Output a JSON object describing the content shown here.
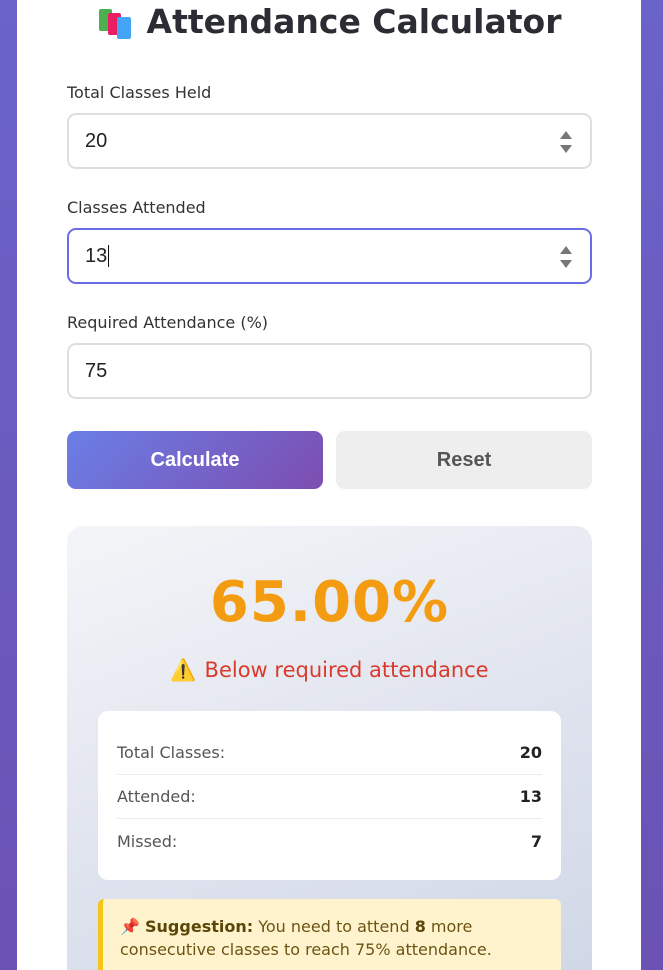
{
  "header": {
    "icon": "books-icon",
    "title": "Attendance Calculator"
  },
  "form": {
    "total_label": "Total Classes Held",
    "total_value": "20",
    "attended_label": "Classes Attended",
    "attended_value": "13",
    "required_label": "Required Attendance (%)",
    "required_value": "75"
  },
  "buttons": {
    "calculate": "Calculate",
    "reset": "Reset"
  },
  "result": {
    "percentage": "65.00%",
    "status_icon": "⚠️",
    "status_text": "Below required attendance",
    "stats": [
      {
        "label": "Total Classes:",
        "value": "20"
      },
      {
        "label": "Attended:",
        "value": "13"
      },
      {
        "label": "Missed:",
        "value": "7"
      }
    ],
    "suggestion": {
      "icon": "📌",
      "lead": "Suggestion:",
      "text_before": "You need to attend",
      "count": "8",
      "text_after": "more consecutive classes to reach 75% attendance."
    }
  },
  "colors": {
    "accent_start": "#6a7fe6",
    "accent_end": "#7d4db0",
    "percentage": "#f39c12",
    "warning": "#d93a2b",
    "suggestion_bg": "#fff3cd",
    "suggestion_border": "#f5c518"
  }
}
